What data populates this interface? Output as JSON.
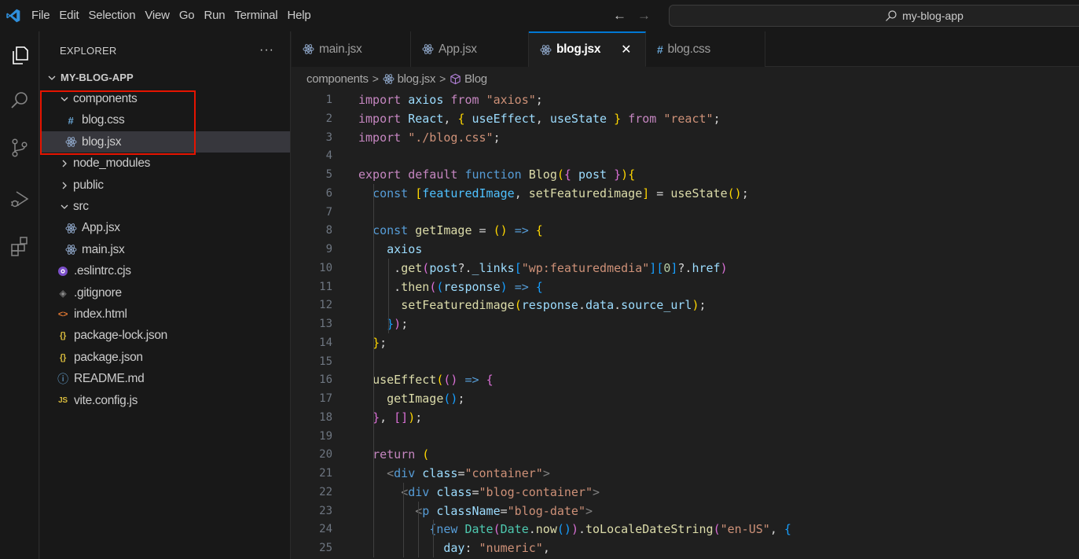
{
  "titlebar": {
    "menu": [
      "File",
      "Edit",
      "Selection",
      "View",
      "Go",
      "Run",
      "Terminal",
      "Help"
    ],
    "back_arrow": "←",
    "forward_arrow": "→",
    "search_text": "my-blog-app"
  },
  "activitybar": {
    "icons": [
      "explorer-icon",
      "search-icon",
      "source-control-icon",
      "run-debug-icon",
      "extensions-icon"
    ]
  },
  "sidebar": {
    "title": "EXPLORER",
    "more": "···",
    "root": "MY-BLOG-APP",
    "items": [
      {
        "label": "components",
        "type": "folder-open",
        "depth": 1
      },
      {
        "label": "blog.css",
        "type": "css",
        "depth": 2
      },
      {
        "label": "blog.jsx",
        "type": "react",
        "depth": 2,
        "selected": true
      },
      {
        "label": "node_modules",
        "type": "folder-closed",
        "depth": 1
      },
      {
        "label": "public",
        "type": "folder-closed",
        "depth": 1
      },
      {
        "label": "src",
        "type": "folder-open",
        "depth": 1
      },
      {
        "label": "App.jsx",
        "type": "react",
        "depth": 2
      },
      {
        "label": "main.jsx",
        "type": "react",
        "depth": 2
      },
      {
        "label": ".eslintrc.cjs",
        "type": "eslint",
        "depth": 1
      },
      {
        "label": ".gitignore",
        "type": "git",
        "depth": 1
      },
      {
        "label": "index.html",
        "type": "html",
        "depth": 1
      },
      {
        "label": "package-lock.json",
        "type": "json",
        "depth": 1
      },
      {
        "label": "package.json",
        "type": "json",
        "depth": 1
      },
      {
        "label": "README.md",
        "type": "info",
        "depth": 1
      },
      {
        "label": "vite.config.js",
        "type": "js",
        "depth": 1
      }
    ],
    "icon_glyphs": {
      "css": "#",
      "json": "{}",
      "html": "<>",
      "js": "JS",
      "info": "ⓘ",
      "git": "◈"
    }
  },
  "editor": {
    "tabs": [
      {
        "label": "main.jsx",
        "icon": "react-icon",
        "active": false
      },
      {
        "label": "App.jsx",
        "icon": "react-icon",
        "active": false
      },
      {
        "label": "blog.jsx",
        "icon": "react-icon",
        "active": true,
        "close": "✕"
      },
      {
        "label": "blog.css",
        "icon": "css-icon",
        "active": false
      }
    ],
    "breadcrumb": [
      "components",
      "blog.jsx",
      "Blog"
    ],
    "lines": [
      {
        "n": "1",
        "tokens": [
          [
            "kw",
            "import "
          ],
          [
            "vr",
            "axios "
          ],
          [
            "kw",
            "from "
          ],
          [
            "sr",
            "\"axios\""
          ],
          [
            "",
            "; "
          ]
        ]
      },
      {
        "n": "2",
        "tokens": [
          [
            "kw",
            "import "
          ],
          [
            "vr",
            "React"
          ],
          [
            "",
            ", "
          ],
          [
            "p1",
            "{ "
          ],
          [
            "vr",
            "useEffect"
          ],
          [
            "",
            ", "
          ],
          [
            "vr",
            "useState "
          ],
          [
            "p1",
            "} "
          ],
          [
            "kw",
            "from "
          ],
          [
            "sr",
            "\"react\""
          ],
          [
            "",
            ";"
          ]
        ]
      },
      {
        "n": "3",
        "tokens": [
          [
            "kw",
            "import "
          ],
          [
            "sr",
            "\"./blog.css\""
          ],
          [
            "",
            ";"
          ]
        ]
      },
      {
        "n": "4",
        "tokens": []
      },
      {
        "n": "5",
        "tokens": [
          [
            "kw",
            "export default "
          ],
          [
            "st",
            "function "
          ],
          [
            "fn",
            "Blog"
          ],
          [
            "p1",
            "("
          ],
          [
            "p2",
            "{ "
          ],
          [
            "vr",
            "post "
          ],
          [
            "p2",
            "}"
          ],
          [
            "p1",
            ")"
          ],
          [
            "",
            ""
          ],
          [
            "p1",
            "{"
          ]
        ]
      },
      {
        "n": "6",
        "tokens": [
          [
            "",
            "  "
          ],
          [
            "st",
            "const "
          ],
          [
            "p1",
            "["
          ],
          [
            "cn",
            "featuredImage"
          ],
          [
            "",
            ", "
          ],
          [
            "fn",
            "setFeaturedimage"
          ],
          [
            "p1",
            "]"
          ],
          [
            "",
            " = "
          ],
          [
            "fn",
            "useState"
          ],
          [
            "p1",
            "()"
          ],
          [
            "",
            ";"
          ]
        ]
      },
      {
        "n": "7",
        "tokens": []
      },
      {
        "n": "8",
        "tokens": [
          [
            "",
            "  "
          ],
          [
            "st",
            "const "
          ],
          [
            "fn",
            "getImage "
          ],
          [
            "",
            "= "
          ],
          [
            "p1",
            "() "
          ],
          [
            "st",
            "=> "
          ],
          [
            "p1",
            "{"
          ]
        ]
      },
      {
        "n": "9",
        "tokens": [
          [
            "",
            "    "
          ],
          [
            "vr",
            "axios"
          ]
        ]
      },
      {
        "n": "10",
        "tokens": [
          [
            "",
            "     ."
          ],
          [
            "fn",
            "get"
          ],
          [
            "p2",
            "("
          ],
          [
            "vr",
            "post"
          ],
          [
            "",
            "?."
          ],
          [
            "vr",
            "_links"
          ],
          [
            "p3",
            "["
          ],
          [
            "sr",
            "\"wp:featuredmedia\""
          ],
          [
            "p3",
            "]"
          ],
          [
            "p3",
            "["
          ],
          [
            "nm",
            "0"
          ],
          [
            "p3",
            "]"
          ],
          [
            "",
            "?."
          ],
          [
            "vr",
            "href"
          ],
          [
            "p2",
            ")"
          ]
        ]
      },
      {
        "n": "11",
        "tokens": [
          [
            "",
            "     ."
          ],
          [
            "fn",
            "then"
          ],
          [
            "p2",
            "("
          ],
          [
            "p3",
            "("
          ],
          [
            "vr",
            "response"
          ],
          [
            "p3",
            ") "
          ],
          [
            "st",
            "=> "
          ],
          [
            "p3",
            "{"
          ]
        ]
      },
      {
        "n": "12",
        "tokens": [
          [
            "",
            "      "
          ],
          [
            "fn",
            "setFeaturedimage"
          ],
          [
            "p1",
            "("
          ],
          [
            "vr",
            "response"
          ],
          [
            "",
            "."
          ],
          [
            "vr",
            "data"
          ],
          [
            "",
            "."
          ],
          [
            "vr",
            "source_url"
          ],
          [
            "p1",
            ")"
          ],
          [
            "",
            ";"
          ]
        ]
      },
      {
        "n": "13",
        "tokens": [
          [
            "",
            "    "
          ],
          [
            "p3",
            "}"
          ],
          [
            "p2",
            ")"
          ],
          [
            "",
            ";"
          ]
        ]
      },
      {
        "n": "14",
        "tokens": [
          [
            "",
            "  "
          ],
          [
            "p1",
            "}"
          ],
          [
            "",
            ";"
          ]
        ]
      },
      {
        "n": "15",
        "tokens": []
      },
      {
        "n": "16",
        "tokens": [
          [
            "",
            "  "
          ],
          [
            "fn",
            "useEffect"
          ],
          [
            "p1",
            "("
          ],
          [
            "p2",
            "() "
          ],
          [
            "st",
            "=> "
          ],
          [
            "p2",
            "{"
          ]
        ]
      },
      {
        "n": "17",
        "tokens": [
          [
            "",
            "    "
          ],
          [
            "fn",
            "getImage"
          ],
          [
            "p3",
            "()"
          ],
          [
            "",
            ";"
          ]
        ]
      },
      {
        "n": "18",
        "tokens": [
          [
            "",
            "  "
          ],
          [
            "p2",
            "}"
          ],
          [
            "",
            ", "
          ],
          [
            "p2",
            "[]"
          ],
          [
            "p1",
            ")"
          ],
          [
            "",
            ";"
          ]
        ]
      },
      {
        "n": "19",
        "tokens": []
      },
      {
        "n": "20",
        "tokens": [
          [
            "",
            "  "
          ],
          [
            "kw",
            "return "
          ],
          [
            "p1",
            "("
          ]
        ]
      },
      {
        "n": "21",
        "tokens": [
          [
            "",
            "    "
          ],
          [
            "gr",
            "<"
          ],
          [
            "tg",
            "div "
          ],
          [
            "at",
            "class"
          ],
          [
            "",
            "="
          ],
          [
            "sr",
            "\"container\""
          ],
          [
            "gr",
            ">"
          ]
        ]
      },
      {
        "n": "22",
        "tokens": [
          [
            "",
            "      "
          ],
          [
            "gr",
            "<"
          ],
          [
            "tg",
            "div "
          ],
          [
            "at",
            "class"
          ],
          [
            "",
            "="
          ],
          [
            "sr",
            "\"blog-container\""
          ],
          [
            "gr",
            ">"
          ]
        ]
      },
      {
        "n": "23",
        "tokens": [
          [
            "",
            "        "
          ],
          [
            "gr",
            "<"
          ],
          [
            "tg",
            "p "
          ],
          [
            "at",
            "className"
          ],
          [
            "",
            "="
          ],
          [
            "sr",
            "\"blog-date\""
          ],
          [
            "gr",
            ">"
          ]
        ]
      },
      {
        "n": "24",
        "tokens": [
          [
            "",
            "          "
          ],
          [
            "st",
            "{"
          ],
          [
            "st",
            "new "
          ],
          [
            "cl",
            "Date"
          ],
          [
            "p2",
            "("
          ],
          [
            "cl",
            "Date"
          ],
          [
            "",
            "."
          ],
          [
            "fn",
            "now"
          ],
          [
            "p3",
            "()"
          ],
          [
            "p2",
            ")"
          ],
          [
            "",
            "."
          ],
          [
            "fn",
            "toLocaleDateString"
          ],
          [
            "p2",
            "("
          ],
          [
            "sr",
            "\"en-US\""
          ],
          [
            "",
            ", "
          ],
          [
            "p3",
            "{"
          ]
        ]
      },
      {
        "n": "25",
        "tokens": [
          [
            "",
            "            "
          ],
          [
            "vr",
            "day"
          ],
          [
            "",
            ": "
          ],
          [
            "sr",
            "\"numeric\""
          ],
          [
            "",
            ","
          ]
        ]
      }
    ]
  }
}
